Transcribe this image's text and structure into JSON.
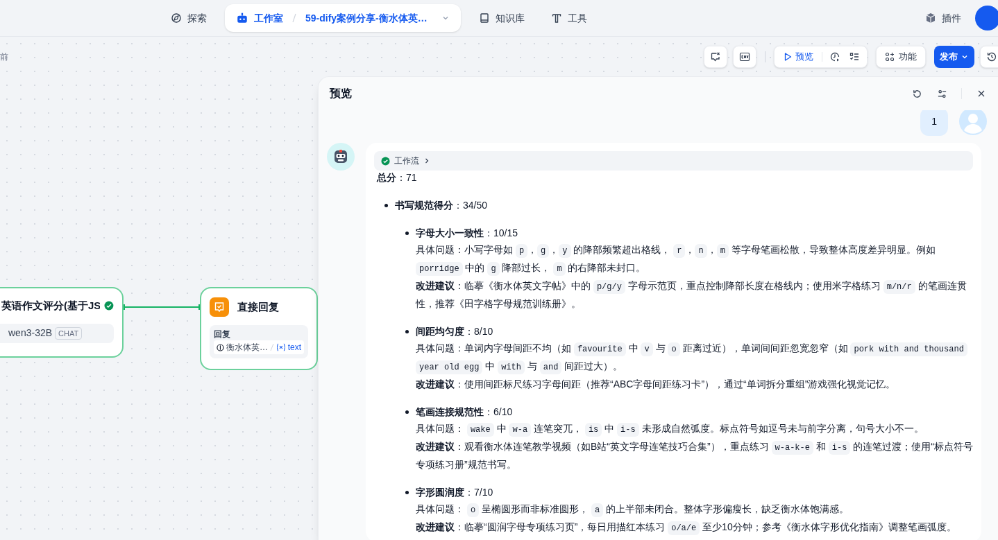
{
  "top_nav": {
    "items": [
      {
        "kind": "link",
        "label": "探索",
        "selected": false
      },
      {
        "kind": "studio",
        "label": "工作室",
        "app_name": "59-dify案例分享-衡水体英…",
        "selected": true
      },
      {
        "kind": "link",
        "label": "知识库",
        "selected": false
      },
      {
        "kind": "link",
        "label": "工具",
        "selected": false
      }
    ],
    "plugins": "插件"
  },
  "canvas": {
    "edited_time": "前",
    "toolbar": {
      "preview": "预览",
      "features": "功能",
      "publish": "发布"
    },
    "nodes": [
      {
        "kind": "llm",
        "title": "英语作文评分(基于JS",
        "model": "wen3-32B",
        "mode": "CHAT",
        "succeeded": true
      },
      {
        "kind": "answer",
        "title": "直接回复",
        "field_label": "回复",
        "var_source": "衡水体英…",
        "var_name": "text"
      }
    ]
  },
  "preview": {
    "title": "预览",
    "user_message": "1",
    "workflow": {
      "label": "工作流",
      "succeeded": true
    },
    "total": {
      "label": "总分",
      "value": "：71"
    },
    "sections": [
      {
        "title": "书写规范得分",
        "score": "：34/50",
        "items": [
          {
            "title": "字母大小一致性",
            "score": "：10/15",
            "paragraphs": [
              [
                {
                  "kind": "text",
                  "text": "具体问题：小写字母如 "
                },
                {
                  "kind": "code",
                  "text": "p"
                },
                {
                  "kind": "text",
                  "text": "，"
                },
                {
                  "kind": "code",
                  "text": "g"
                },
                {
                  "kind": "text",
                  "text": "，"
                },
                {
                  "kind": "code",
                  "text": "y"
                },
                {
                  "kind": "text",
                  "text": " 的降部频繁超出格线， "
                },
                {
                  "kind": "code",
                  "text": "r"
                },
                {
                  "kind": "text",
                  "text": "，"
                },
                {
                  "kind": "code",
                  "text": "n"
                },
                {
                  "kind": "text",
                  "text": "，"
                },
                {
                  "kind": "code",
                  "text": "m"
                },
                {
                  "kind": "text",
                  "text": " 等字母笔画松散，导致整体高度差异明显。例如 "
                },
                {
                  "kind": "code",
                  "text": "porridge"
                },
                {
                  "kind": "text",
                  "text": " 中的 "
                },
                {
                  "kind": "code",
                  "text": "g"
                },
                {
                  "kind": "text",
                  "text": " 降部过长， "
                },
                {
                  "kind": "code",
                  "text": "m"
                },
                {
                  "kind": "text",
                  "text": " 的右降部未封口。"
                }
              ],
              [
                {
                  "kind": "bold",
                  "text": "改进建议"
                },
                {
                  "kind": "text",
                  "text": "：临摹《衡水体英文字帖》中的 "
                },
                {
                  "kind": "code",
                  "text": "p/g/y"
                },
                {
                  "kind": "text",
                  "text": " 字母示范页，重点控制降部长度在格线内；使用米字格练习 "
                },
                {
                  "kind": "code",
                  "text": "m/n/r"
                },
                {
                  "kind": "text",
                  "text": " 的笔画连贯性，推荐《田字格字母规范训练册》。"
                }
              ]
            ]
          },
          {
            "title": "间距均匀度",
            "score": "：8/10",
            "paragraphs": [
              [
                {
                  "kind": "text",
                  "text": "具体问题：单词内字母间距不均（如 "
                },
                {
                  "kind": "code",
                  "text": "favourite"
                },
                {
                  "kind": "text",
                  "text": " 中 "
                },
                {
                  "kind": "code",
                  "text": "v"
                },
                {
                  "kind": "text",
                  "text": " 与 "
                },
                {
                  "kind": "code",
                  "text": "o"
                },
                {
                  "kind": "text",
                  "text": " 距离过近），单词间间距忽宽忽窄（如 "
                },
                {
                  "kind": "code",
                  "text": "pork with and thousand year old egg"
                },
                {
                  "kind": "text",
                  "text": " 中 "
                },
                {
                  "kind": "code",
                  "text": "with"
                },
                {
                  "kind": "text",
                  "text": " 与 "
                },
                {
                  "kind": "code",
                  "text": "and"
                },
                {
                  "kind": "text",
                  "text": " 间距过大）。"
                }
              ],
              [
                {
                  "kind": "bold",
                  "text": "改进建议"
                },
                {
                  "kind": "text",
                  "text": "：使用间距标尺练习字母间距（推荐“ABC字母间距练习卡”），通过“单词拆分重组”游戏强化视觉记忆。"
                }
              ]
            ]
          },
          {
            "title": "笔画连接规范性",
            "score": "：6/10",
            "paragraphs": [
              [
                {
                  "kind": "text",
                  "text": "具体问题： "
                },
                {
                  "kind": "code",
                  "text": "wake"
                },
                {
                  "kind": "text",
                  "text": " 中 "
                },
                {
                  "kind": "code",
                  "text": "w-a"
                },
                {
                  "kind": "text",
                  "text": " 连笔突兀， "
                },
                {
                  "kind": "code",
                  "text": "is"
                },
                {
                  "kind": "text",
                  "text": " 中 "
                },
                {
                  "kind": "code",
                  "text": "i-s"
                },
                {
                  "kind": "text",
                  "text": " 未形成自然弧度。标点符号如逗号未与前字分离，句号大小不一。"
                }
              ],
              [
                {
                  "kind": "bold",
                  "text": "改进建议"
                },
                {
                  "kind": "text",
                  "text": "：观看衡水体连笔教学视频（如B站“英文字母连笔技巧合集”），重点练习 "
                },
                {
                  "kind": "code",
                  "text": "w-a-k-e"
                },
                {
                  "kind": "text",
                  "text": " 和 "
                },
                {
                  "kind": "code",
                  "text": "i-s"
                },
                {
                  "kind": "text",
                  "text": " 的连笔过渡；使用“标点符号专项练习册”规范书写。"
                }
              ]
            ]
          },
          {
            "title": "字形圆润度",
            "score": "：7/10",
            "paragraphs": [
              [
                {
                  "kind": "text",
                  "text": "具体问题： "
                },
                {
                  "kind": "code",
                  "text": "o"
                },
                {
                  "kind": "text",
                  "text": " 呈椭圆形而非标准圆形， "
                },
                {
                  "kind": "code",
                  "text": "a"
                },
                {
                  "kind": "text",
                  "text": " 的上半部未闭合。整体字形偏瘦长，缺乏衡水体饱满感。"
                }
              ],
              [
                {
                  "kind": "bold",
                  "text": "改进建议"
                },
                {
                  "kind": "text",
                  "text": "：临摹“圆润字母专项练习页”，每日用描红本练习 "
                },
                {
                  "kind": "code",
                  "text": "o/a/e"
                },
                {
                  "kind": "text",
                  "text": " 至少10分钟；参考《衡水体字形优化指南》调整笔画弧度。"
                }
              ]
            ]
          }
        ]
      }
    ]
  }
}
